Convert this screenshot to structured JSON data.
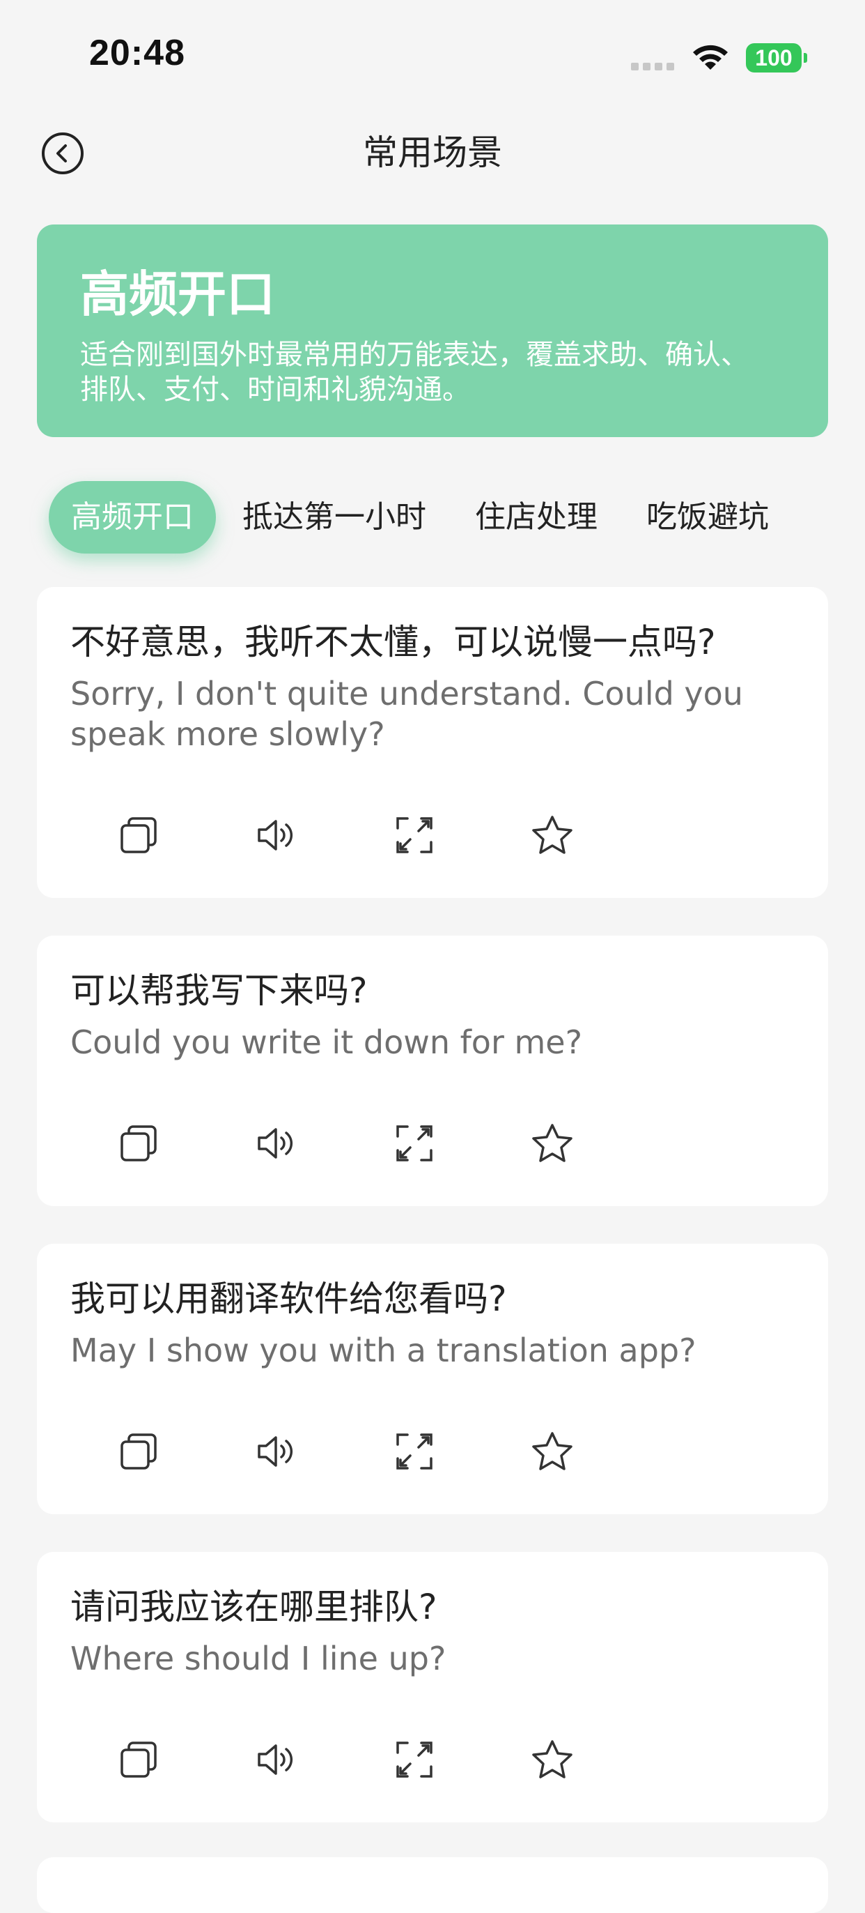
{
  "status_bar": {
    "time": "20:48",
    "battery": "100"
  },
  "nav": {
    "title": "常用场景"
  },
  "hero": {
    "title": "高频开口",
    "description": "适合刚到国外时最常用的万能表达，覆盖求助、确认、排队、支付、时间和礼貌沟通。"
  },
  "tabs": [
    {
      "label": "高频开口",
      "active": true
    },
    {
      "label": "抵达第一小时",
      "active": false
    },
    {
      "label": "住店处理",
      "active": false
    },
    {
      "label": "吃饭避坑",
      "active": false
    }
  ],
  "phrases": [
    {
      "zh": "不好意思，我听不太懂，可以说慢一点吗?",
      "en": "Sorry, I don't quite understand. Could you speak more slowly?"
    },
    {
      "zh": "可以帮我写下来吗?",
      "en": "Could you write it down for me?"
    },
    {
      "zh": "我可以用翻译软件给您看吗?",
      "en": "May I show you with a translation app?"
    },
    {
      "zh": "请问我应该在哪里排队?",
      "en": "Where should I line up?"
    }
  ],
  "actions": [
    {
      "name": "copy-icon"
    },
    {
      "name": "speaker-icon"
    },
    {
      "name": "fullscreen-icon"
    },
    {
      "name": "star-icon"
    }
  ],
  "colors": {
    "accent": "#7ed4ab",
    "background": "#f5f5f5",
    "battery": "#34c759"
  }
}
